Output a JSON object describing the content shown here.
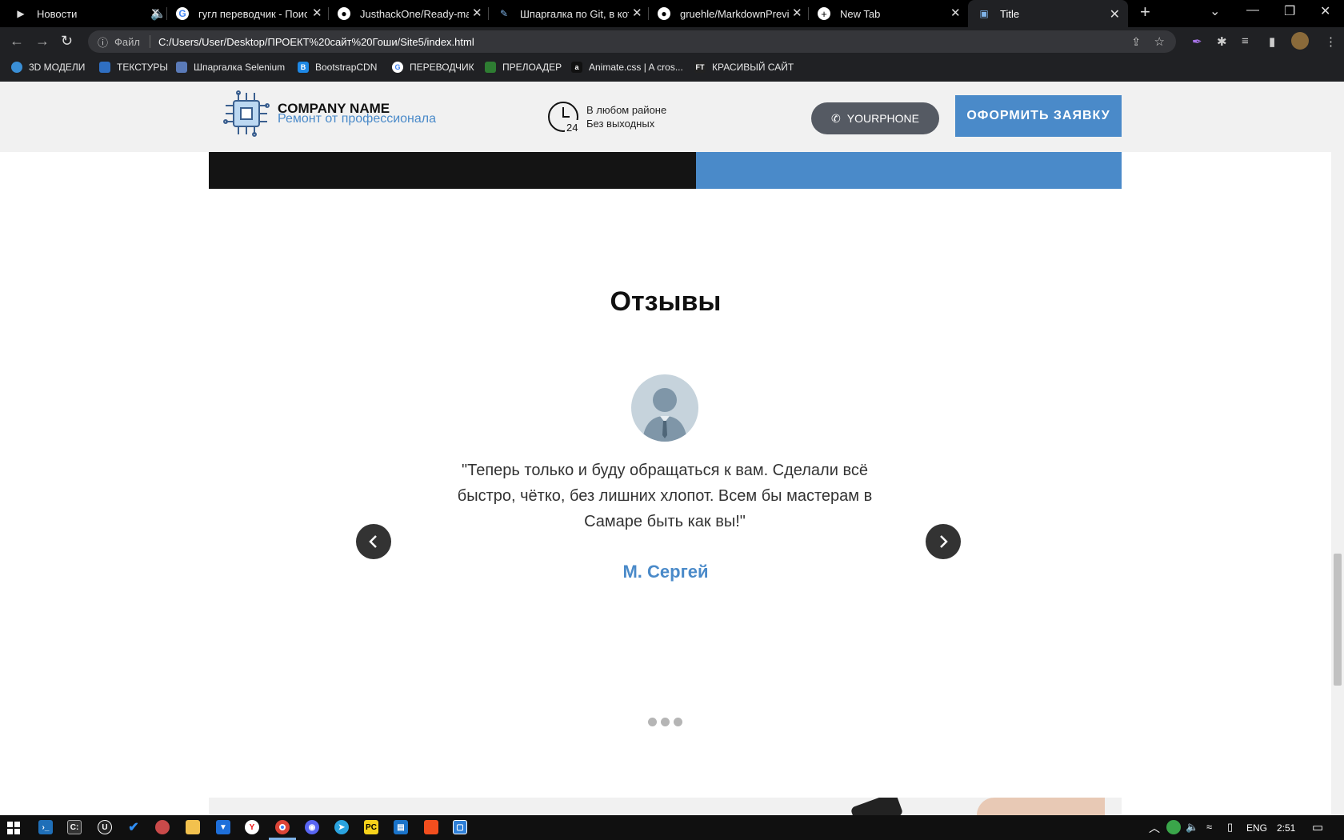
{
  "browser": {
    "tabs": [
      {
        "label": "Новости",
        "icon": "play-icon"
      },
      {
        "label": "гугл переводчик - Поиск",
        "icon": "google-icon"
      },
      {
        "label": "JusthackOne/Ready-made",
        "icon": "github-icon"
      },
      {
        "label": "Шпаргалка по Git, в кото",
        "icon": "git-icon"
      },
      {
        "label": "gruehle/MarkdownPreview",
        "icon": "github-icon"
      },
      {
        "label": "New Tab",
        "icon": "new-tab-icon"
      },
      {
        "label": "Title",
        "icon": "page-icon"
      }
    ],
    "file_label": "Файл",
    "url": "C:/Users/User/Desktop/ПРОЕКТ%20сайт%20Гоши/Site5/index.html",
    "bookmarks": [
      {
        "label": "3D МОДЕЛИ",
        "color": "#3a8fd6"
      },
      {
        "label": "ТЕКСТУРЫ",
        "color": "#2f6fc2"
      },
      {
        "label": "Шпаргалка Selenium",
        "color": "#5a7ab8"
      },
      {
        "label": "BootstrapCDN",
        "color": "#1e88e5"
      },
      {
        "label": "ПЕРЕВОДЧИК",
        "color": "#4285f4"
      },
      {
        "label": "ПРЕЛОАДЕР",
        "color": "#2e7d32"
      },
      {
        "label": "Animate.css | A cros...",
        "color": "#111111"
      },
      {
        "label": "КРАСИВЫЙ САЙТ",
        "color": "#222222"
      }
    ]
  },
  "header": {
    "company": "COMPANY NAME",
    "tagline": "Ремонт от профессионала",
    "clock_number": "24",
    "hours_line1": "В любом районе",
    "hours_line2": "Без выходных",
    "phone": "YOURPHONE",
    "order_button": "ОФОРМИТЬ ЗАЯВКУ"
  },
  "reviews": {
    "title": "Отзывы",
    "quote": "\"Теперь только и буду обращаться к вам. Сделали всё быстро, чётко, без лишних хлопот. Всем бы мастерам в Самаре быть как вы!\"",
    "author": "М. Сергей",
    "slide_count": 3
  },
  "taskbar": {
    "lang": "ENG",
    "time": "2:51"
  },
  "colors": {
    "accent": "#4a8ac9",
    "header_bg": "#f1f1f1",
    "phone_button": "#555a63"
  }
}
